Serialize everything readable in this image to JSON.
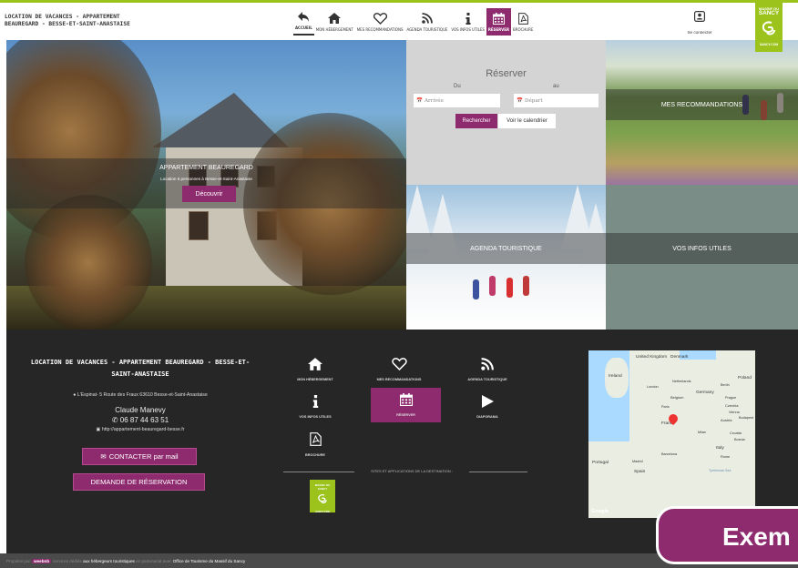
{
  "header": {
    "site_title_line1": "Location de vacances - appartement",
    "site_title_line2": "Beauregard - Besse-et-Saint-Anastaise",
    "nav": [
      {
        "label": "ACCUEIL",
        "icon": "back-arrow-icon",
        "active": false
      },
      {
        "label": "MON HÉBERGEMENT",
        "icon": "home-icon",
        "active": false
      },
      {
        "label": "MES RECOMMANDATIONS",
        "icon": "heart-icon",
        "active": false
      },
      {
        "label": "AGENDA TOURISTIQUE",
        "icon": "rss-icon",
        "active": false
      },
      {
        "label": "VOS INFOS UTILES",
        "icon": "info-icon",
        "active": false
      },
      {
        "label": "RÉSERVER",
        "icon": "calendar-icon",
        "active": true
      },
      {
        "label": "BROCHURE",
        "icon": "pdf-icon",
        "active": false
      }
    ],
    "login_label": "Se connecter",
    "brand_top": "MASSIF DU",
    "brand_name": "SANCY",
    "brand_bottom": "SANCY.COM"
  },
  "main_tile": {
    "title": "APPARTEMENT BEAUREGARD",
    "subtitle": "Location 6 personnes à Besse-et-Saint-Anastaise",
    "button": "Découvrir"
  },
  "reserver": {
    "title": "Réserver",
    "du": "Du",
    "au": "au",
    "arrivee_placeholder": "Arrivée",
    "depart_placeholder": "Départ",
    "search_button": "Rechercher",
    "calendar_button": "Voir le calendrier"
  },
  "tiles": {
    "recommandations": "MES RECOMMANDATIONS",
    "agenda": "AGENDA TOURISTIQUE",
    "infos": "VOS INFOS UTILES"
  },
  "footer": {
    "title": "Location de vacances - appartement Beauregard - Besse-et-Saint-Anastaise",
    "address": "L'Espinat- 5 Route des Fraux 63610 Besse-et-Saint-Anastaise",
    "contact_name": "Claude Manevy",
    "phone": "06 87 44 63 51",
    "url": "http://appartement-beauregard-besse.fr",
    "contact_button": "CONTACTER par mail",
    "booking_button": "DEMANDE DE RÉSERVATION",
    "nav": [
      {
        "label": "MON HÉBERGEMENT",
        "icon": "home-icon"
      },
      {
        "label": "MES RECOMMANDATIONS",
        "icon": "heart-icon"
      },
      {
        "label": "AGENDA TOURISTIQUE",
        "icon": "rss-icon"
      },
      {
        "label": "VOS INFOS UTILES",
        "icon": "info-icon"
      },
      {
        "label": "RÉSERVER",
        "icon": "calendar-icon"
      },
      {
        "label": "DIAPORAMA",
        "icon": "play-icon"
      },
      {
        "label": "BROCHURE",
        "icon": "pdf-icon"
      }
    ],
    "sites_label": "SITES ET APPLICATIONS DE LA DESTINATION :",
    "app_logo_top": "MASSIF DU SANCY",
    "app_logo_bottom": "SANCY.COM"
  },
  "map": {
    "labels": [
      "United Kingdom",
      "Denmark",
      "Ireland",
      "Netherlands",
      "Poland",
      "London",
      "Berlin",
      "Belgium",
      "Germany",
      "Prague",
      "Paris",
      "Czechia",
      "France",
      "Vienna",
      "Austria",
      "Budapest",
      "Croatia",
      "Milan",
      "Italy",
      "Bosnia",
      "Portugal",
      "Madrid",
      "Spain",
      "Barcelona",
      "Rome",
      "Tyrrhenian Sea"
    ],
    "attribution": "Google"
  },
  "badge_text": "Exem",
  "bottom_bar": {
    "prefix": "Propulsé par",
    "webo": "weebnb",
    "middle": "services dédiés",
    "link1": "aux hébergeurs touristiques",
    "middle2": "en partenariat avec",
    "link2": "Office de Tourisme du Massif du Sancy"
  },
  "colors": {
    "accent": "#8e2a6e",
    "brand_green": "#9bc31c",
    "footer_bg": "#262626"
  }
}
